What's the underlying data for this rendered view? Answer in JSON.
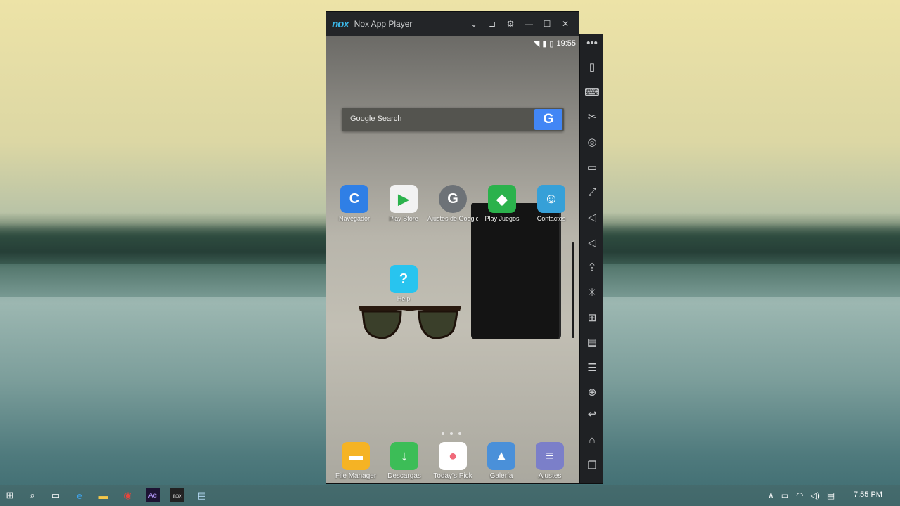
{
  "window": {
    "logo": "nox",
    "title": "Nox App Player",
    "controls": [
      "chevron-down-icon",
      "pin-icon",
      "gear-icon",
      "minimize-icon",
      "maximize-icon",
      "close-icon"
    ]
  },
  "status": {
    "time": "19:55"
  },
  "search": {
    "label": "Google Search",
    "button": "G"
  },
  "apps": [
    {
      "label": "Navegador",
      "icon": "C",
      "color": "#2f7fe6"
    },
    {
      "label": "Play Store",
      "icon": "▶",
      "color": "#f2f2f2"
    },
    {
      "label": "Ajustes de Google",
      "icon": "G",
      "color": "#6d7277"
    },
    {
      "label": "Play Juegos",
      "icon": "◆",
      "color": "#2bb24c"
    },
    {
      "label": "Contactos",
      "icon": "☺",
      "color": "#36a0d8"
    },
    {
      "label": "Help",
      "icon": "?",
      "color": "#28c4ef"
    }
  ],
  "dock": [
    {
      "label": "File Manager",
      "icon": "▬",
      "color": "#f5b324"
    },
    {
      "label": "Descargas",
      "icon": "↓",
      "color": "#3cbd57"
    },
    {
      "label": "Today's Pick",
      "icon": "●",
      "color": "#ffffff"
    },
    {
      "label": "Galería",
      "icon": "▲",
      "color": "#4a90d9"
    },
    {
      "label": "Ajustes",
      "icon": "≡",
      "color": "#7b7fc9"
    }
  ],
  "side_toolbar": [
    "more-icon",
    "shake-icon",
    "keyboard-icon",
    "scissors-icon",
    "location-icon",
    "screen-icon",
    "fullscreen-icon",
    "volume-up-icon",
    "volume-down-icon",
    "apk-install-icon",
    "loading-icon",
    "multi-instance-icon",
    "screenshot-icon",
    "macro-icon",
    "add-icon",
    "back-icon",
    "home-icon",
    "recents-icon"
  ],
  "taskbar": {
    "clock": "7:55 PM"
  }
}
